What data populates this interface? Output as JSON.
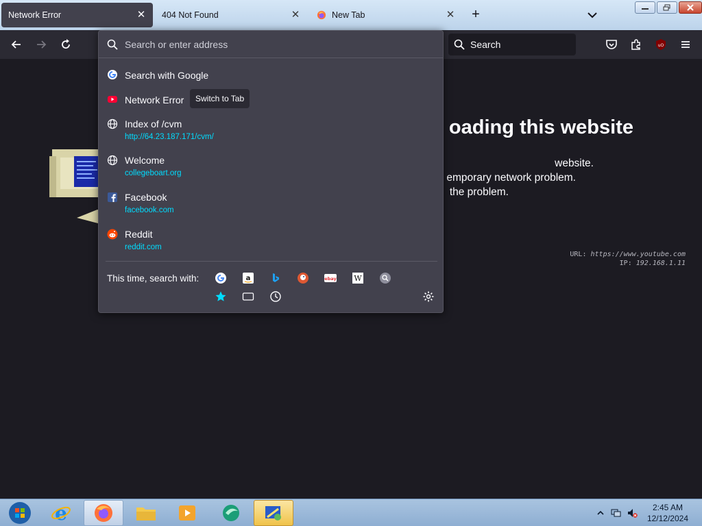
{
  "tabs": [
    {
      "label": "Network Error",
      "active": true
    },
    {
      "label": "404 Not Found",
      "active": false
    },
    {
      "label": "New Tab",
      "active": false
    }
  ],
  "searchbar": {
    "placeholder": "Search"
  },
  "page": {
    "heading": "oading this website",
    "lines": [
      "website.",
      "emporary network problem.",
      "the problem."
    ],
    "diag_url_label": "URL:",
    "diag_url": "https://www.youtube.com",
    "diag_ip_label": "IP:",
    "diag_ip": "192.168.1.11"
  },
  "urlbar": {
    "placeholder": "Search or enter address",
    "results": [
      {
        "title": "Search with Google",
        "url": "",
        "icon": "google-icon"
      },
      {
        "title": "Network Error",
        "url": "",
        "icon": "youtube-icon",
        "badge": "Switch to Tab"
      },
      {
        "title": "Index of /cvm",
        "url": "http://64.23.187.171/cvm/",
        "icon": "globe-icon"
      },
      {
        "title": "Welcome",
        "url": "collegeboart.org",
        "icon": "globe-icon"
      },
      {
        "title": "Facebook",
        "url": "facebook.com",
        "icon": "facebook-icon"
      },
      {
        "title": "Reddit",
        "url": "reddit.com",
        "icon": "reddit-icon"
      }
    ],
    "oneoff_label": "This time, search with:",
    "engines": [
      "google-icon",
      "amazon-icon",
      "bing-icon",
      "duckduckgo-icon",
      "ebay-icon",
      "wikipedia-icon",
      "search-engine-icon",
      "bookmarks-star-icon",
      "tabs-icon",
      "history-icon"
    ]
  },
  "taskbar": {
    "time": "2:45 AM",
    "date": "12/12/2024"
  },
  "colors": {
    "accent_url": "#00ddff",
    "panel": "#42414d",
    "toolbar": "#2b2a33",
    "page": "#1c1b22"
  }
}
